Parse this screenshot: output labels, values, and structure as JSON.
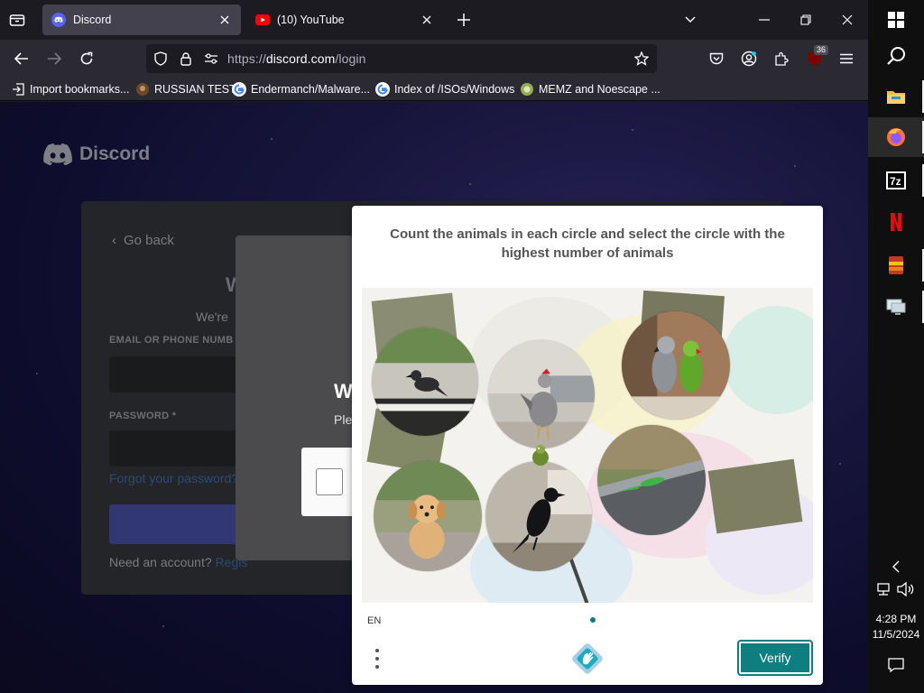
{
  "browser": {
    "tabs": [
      {
        "label": "Discord",
        "active": true
      },
      {
        "label": "(10) YouTube",
        "active": false
      }
    ],
    "url": {
      "prefix": "https://",
      "host": "discord.com",
      "path": "/login"
    },
    "notification_badge": "36",
    "bookmarks": [
      {
        "label": "Import bookmarks...",
        "icon": "import-icon"
      },
      {
        "label": "RUSSIAN TEST",
        "icon": "bookmark-favicon"
      },
      {
        "label": "Endermanch/Malware...",
        "icon": "google-icon"
      },
      {
        "label": "Index of /ISOs/Windows",
        "icon": "google-icon"
      },
      {
        "label": "MEMZ and Noescape ...",
        "icon": "bookmark-favicon"
      }
    ]
  },
  "discord": {
    "brand": "Discord",
    "go_back": "Go back",
    "heading_partial": "W",
    "subheading_partial": "We're",
    "email_label": "EMAIL OR PHONE NUMB",
    "password_label": "PASSWORD *",
    "forgot": "Forgot your password?",
    "need_account": "Need an account?",
    "register": "Regis",
    "modal_title_partial": "W",
    "modal_sub_partial": "Ple"
  },
  "captcha": {
    "prompt": "Count the animals in each circle and select the circle with the highest number of animals",
    "language": "EN",
    "verify_label": "Verify",
    "circles": [
      {
        "subject": "crow on piano",
        "animal_count": 1
      },
      {
        "subject": "rooster in living room",
        "animal_count": 1
      },
      {
        "subject": "two parrots",
        "animal_count": 2
      },
      {
        "subject": "lizard on railing",
        "animal_count": 1
      },
      {
        "subject": "puppy",
        "animal_count": 1
      },
      {
        "subject": "crow on table",
        "animal_count": 1
      }
    ],
    "accent_color": "#0f7e80"
  },
  "taskbar": {
    "time": "4:28 PM",
    "date": "11/5/2024"
  }
}
